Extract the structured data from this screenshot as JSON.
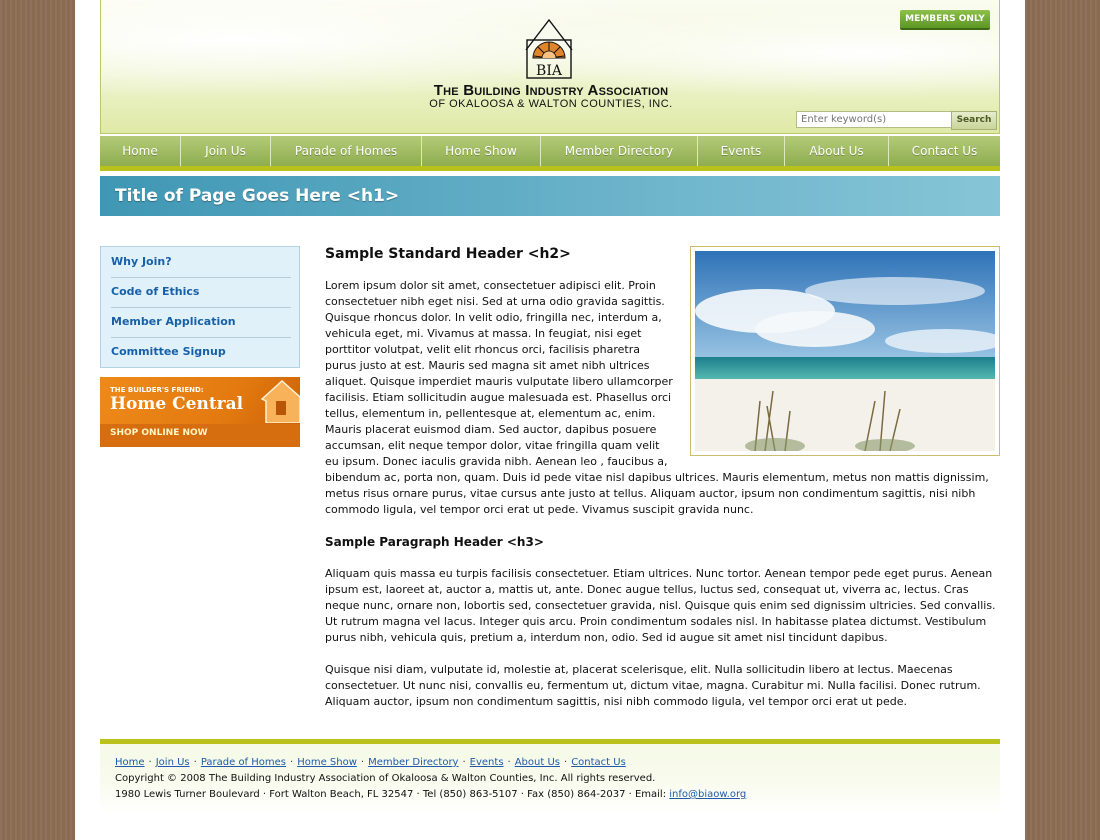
{
  "header": {
    "members_only": "MEMBERS ONLY",
    "logo_text": "BIA",
    "org_line1": "The Building Industry Association",
    "org_line2": "of Okaloosa & Walton Counties, Inc.",
    "search_placeholder": "Enter keyword(s)",
    "search_button": "Search"
  },
  "nav": {
    "items": [
      {
        "label": "Home"
      },
      {
        "label": "Join Us"
      },
      {
        "label": "Parade of Homes"
      },
      {
        "label": "Home Show"
      },
      {
        "label": "Member Directory"
      },
      {
        "label": "Events"
      },
      {
        "label": "About Us"
      },
      {
        "label": "Contact Us"
      }
    ]
  },
  "page_title": "Title of Page Goes Here <h1>",
  "sidebar": {
    "items": [
      {
        "label": "Why Join?"
      },
      {
        "label": "Code of Ethics"
      },
      {
        "label": "Member Application"
      },
      {
        "label": "Committee Signup"
      }
    ],
    "promo": {
      "kicker": "THE BUILDER'S FRIEND:",
      "title": "Home Central",
      "cta": "SHOP ONLINE NOW"
    }
  },
  "content": {
    "h2": "Sample Standard Header <h2>",
    "p1_lines": [
      "Lorem ipsum dolor sit amet, consectetuer adipisci elit. Proin",
      "consectetuer nibh eget nisi. Sed at urna odio gravida sagittis.",
      "Quisque rhoncus dolor. In velit odio, fringilla nec, interdum a,",
      "vehicula eget, mi. Vivamus at massa. In feugiat, nisi eget",
      "porttitor volutpat, velit elit rhoncus orci, facilisis pharetra",
      "purus justo at est. Mauris sed magna sit amet nibh ultrices",
      "aliquet. Quisque imperdiet mauris vulputate libero ullamcorper",
      "facilisis. Etiam sollicitudin augue malesuada est. Phasellus orci",
      "tellus, elementum in, pellentesque at, elementum ac, enim.",
      "Mauris placerat euismod diam. Sed auctor, dapibus posuere",
      "accumsan, elit neque tempor dolor, vitae fringilla quam velit",
      "eu ipsum. Donec iaculis gravida nibh. Aenean leo , faucibus a,",
      "bibendum ac, porta non, quam. Duis id pede vitae nisl dapibus ultrices. Mauris elementum, metus non mattis dignissim,",
      "metus risus ornare purus, vitae cursus ante justo at tellus. Aliquam auctor, ipsum non condimentum sagittis, nisi nibh",
      "commodo ligula, vel tempor orci erat ut pede. Vivamus suscipit gravida nunc."
    ],
    "h3": "Sample Paragraph Header <h3>",
    "p2_lines": [
      "Aliquam quis massa eu turpis facilisis consectetuer. Etiam ultrices. Nunc tortor. Aenean tempor pede eget purus. Aenean",
      "ipsum est, laoreet at, auctor a, mattis ut, ante. Donec augue tellus, luctus sed, consequat ut, viverra ac, lectus. Cras",
      "neque nunc, ornare non, lobortis sed, consectetuer gravida, nisl. Quisque quis enim sed dignissim ultricies. Sed convallis.",
      "Ut rutrum magna vel lacus. Integer quis arcu. Proin condimentum sodales nisl. In habitasse platea dictumst. Vestibulum",
      "purus nibh, vehicula quis, pretium a, interdum non, odio. Sed id augue sit amet nisl tincidunt dapibus."
    ],
    "p3_lines": [
      "Quisque nisi diam, vulputate id, molestie at, placerat scelerisque, elit. Nulla sollicitudin libero at lectus. Maecenas",
      "consectetuer. Ut nunc nisi, convallis eu, fermentum ut, dictum vitae, magna. Curabitur mi. Nulla facilisi. Donec rutrum.",
      "Aliquam auctor, ipsum non condimentum sagittis, nisi nibh commodo ligula, vel tempor orci erat ut pede."
    ]
  },
  "footer": {
    "links": [
      {
        "label": "Home"
      },
      {
        "label": "Join Us"
      },
      {
        "label": "Parade of Homes"
      },
      {
        "label": "Home Show"
      },
      {
        "label": "Member Directory"
      },
      {
        "label": "Events"
      },
      {
        "label": "About Us"
      },
      {
        "label": "Contact Us"
      }
    ],
    "separator": "·",
    "copyright": "Copyright © 2008 The Building Industry Association of Okaloosa & Walton Counties, Inc. All rights reserved.",
    "address": "1980 Lewis Turner Boulevard · Fort Walton Beach, FL 32547 · Tel (850) 863-5107 · Fax (850) 864-2037 · Email:",
    "email": "info@biaow.org"
  }
}
